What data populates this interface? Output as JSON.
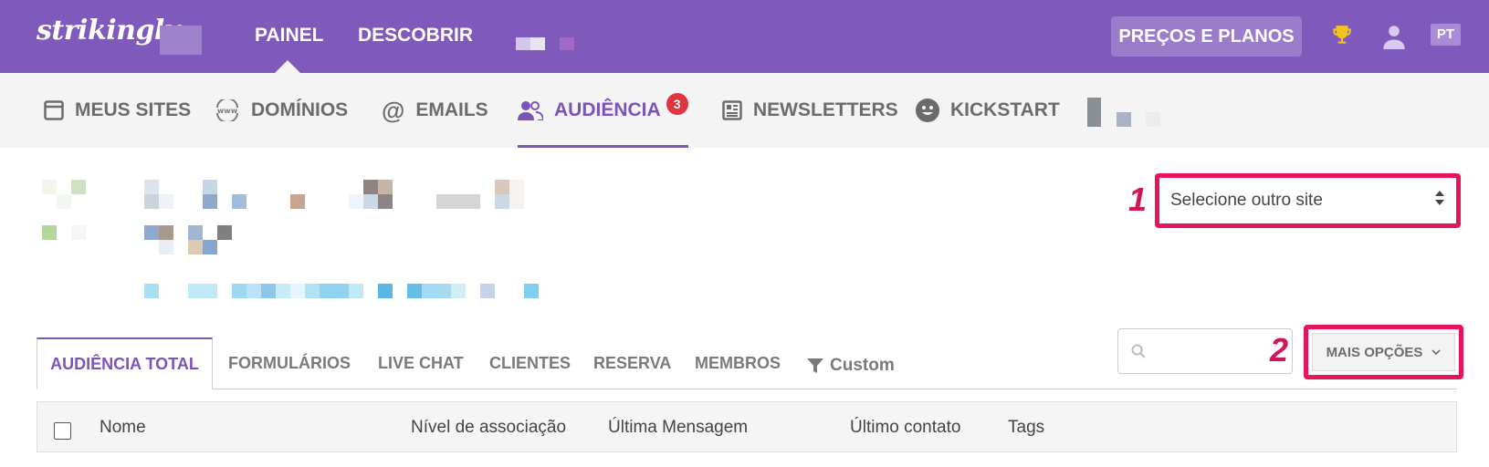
{
  "topbar": {
    "logo": "strikingly",
    "nav": [
      "PAINEL",
      "DESCOBRIR"
    ],
    "pricing_label": "PREÇOS E PLANOS",
    "lang": "PT",
    "colors": {
      "primary": "#8059bc",
      "accent": "#d4145a"
    }
  },
  "subnav": {
    "items": [
      {
        "label": "MEUS SITES",
        "icon": "browser-window-icon"
      },
      {
        "label": "DOMÍNIOS",
        "icon": "www-globe-icon"
      },
      {
        "label": "EMAILS",
        "icon": "at-sign-icon"
      },
      {
        "label": "AUDIÊNCIA",
        "icon": "users-icon",
        "badge": "3",
        "active": true
      },
      {
        "label": "NEWSLETTERS",
        "icon": "newspaper-icon"
      },
      {
        "label": "KICKSTART",
        "icon": "smiley-icon"
      }
    ]
  },
  "site_select": {
    "label": "Selecione outro site"
  },
  "annotations": {
    "one": "1",
    "two": "2"
  },
  "tabs": {
    "items": [
      "AUDIÊNCIA TOTAL",
      "FORMULÁRIOS",
      "LIVE CHAT",
      "CLIENTES",
      "RESERVA",
      "MEMBROS"
    ],
    "custom_label": "Custom",
    "more_label": "MAIS OPÇÕES"
  },
  "table": {
    "headers": [
      "Nome",
      "Nível de associação",
      "Última Mensagem",
      "Último contato",
      "Tags"
    ]
  }
}
